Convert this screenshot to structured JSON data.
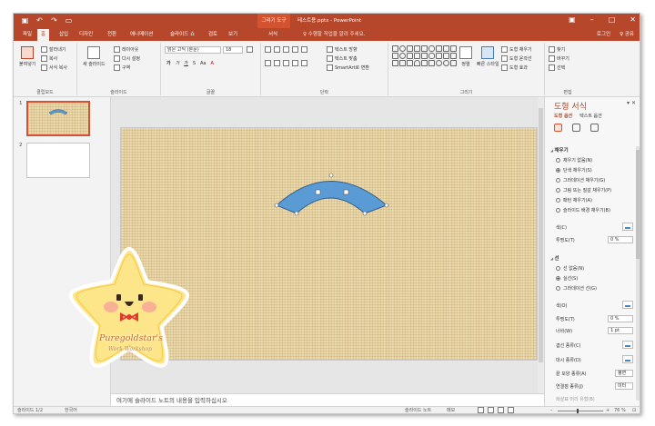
{
  "titlebar": {
    "context_tab": "그리기 도구",
    "doc_title": "테스트용.pptx - PowerPoint",
    "qat_icons": [
      "save-icon",
      "undo-icon",
      "redo-icon",
      "start-icon"
    ],
    "window_buttons": [
      "restore-ribbon-icon",
      "minimize-icon",
      "maximize-icon",
      "close-icon"
    ]
  },
  "tabs": [
    "파일",
    "홈",
    "삽입",
    "디자인",
    "전환",
    "애니메이션",
    "슬라이드 쇼",
    "검토",
    "보기",
    "서식"
  ],
  "active_tab": "홈",
  "tell_me": "♀ 수행할 작업을 알려 주세요.",
  "login": "로그인",
  "share": "♀ 공유",
  "ribbon": {
    "clipboard": {
      "paste": "붙여넣기",
      "cut": "잘라내기",
      "copy": "복사",
      "format_painter": "서식 복사",
      "label": "클립보드"
    },
    "slides": {
      "new_slide": "새 슬라이드",
      "layout": "레이아웃",
      "reset": "다시 설정",
      "section": "구역",
      "label": "슬라이드"
    },
    "font": {
      "font_name": "맑은 고딕 (본문)",
      "font_size": "18",
      "label": "글꼴",
      "bold": "가",
      "italic": "가",
      "underline": "가",
      "strike": "S",
      "case": "Aa"
    },
    "paragraph": {
      "text_direction": "텍스트 방향",
      "align_text": "텍스트 맞춤",
      "smartart": "SmartArt로 변환",
      "label": "단락"
    },
    "drawing": {
      "arrange": "정렬",
      "quick_styles": "빠른 스타일",
      "fill": "도형 채우기",
      "outline": "도형 윤곽선",
      "effects": "도형 효과",
      "label": "그리기"
    },
    "editing": {
      "find": "찾기",
      "replace": "바꾸기",
      "select": "선택",
      "label": "편집"
    }
  },
  "slides": [
    {
      "number": "1",
      "selected": true
    },
    {
      "number": "2",
      "selected": false
    }
  ],
  "sticker": {
    "line1": "Puregoldstar's",
    "line2": "Work Workshop",
    "star_color": "#fde68a",
    "bow_color": "#e23b2e"
  },
  "notes_placeholder": "여기에 슬라이드 노트의 내용을 입력하십시오",
  "format_pane": {
    "title": "도형 서식",
    "tab_shape": "도형 옵션",
    "tab_text": "텍스트 옵션",
    "fill_section": "채우기",
    "fill_options": [
      "채우기 없음(N)",
      "단색 채우기(S)",
      "그라데이션 채우기(G)",
      "그림 또는 질감 채우기(P)",
      "패턴 채우기(A)",
      "슬라이드 배경 채우기(B)"
    ],
    "fill_selected": 1,
    "color_label": "색(C)",
    "transparency_label": "투명도(T)",
    "fill_transparency": "0 %",
    "line_section": "선",
    "line_options": [
      "선 없음(N)",
      "실선(S)",
      "그라데이션 선(G)"
    ],
    "line_selected": 1,
    "line_color_label": "색(O)",
    "line_transparency": "0 %",
    "width_label": "너비(W)",
    "width_value": "1 pt",
    "compound_label": "겹선 종류(C)",
    "dash_label": "대시 종류(D)",
    "cap_label": "끝 모양 종류(A)",
    "cap_value": "평면",
    "join_label": "연결점 종류(J)",
    "join_value": "미터",
    "begin_arrow_label": "화살표 머리 유형(B)"
  },
  "statusbar": {
    "slide_info": "슬라이드 1/2",
    "language": "한국어",
    "notes": "슬라이드 노트",
    "comments": "메모",
    "zoom": "76 %"
  },
  "shape": {
    "fill": "#5b9bd5",
    "stroke": "#2e5f8a"
  }
}
